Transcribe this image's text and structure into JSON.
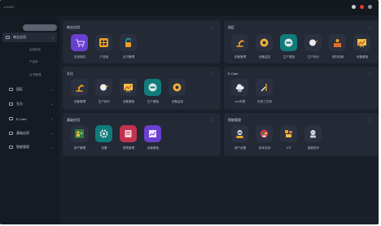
{
  "header": {
    "logo": "LOGO",
    "icons": [
      "settings-icon",
      "notification-icon",
      "avatar-icon"
    ]
  },
  "sidebar": {
    "items": [
      {
        "label": "商业应用",
        "expanded": true
      },
      {
        "label": "园区"
      },
      {
        "label": "孔位"
      },
      {
        "label": "E-Cam"
      },
      {
        "label": "基础应用"
      },
      {
        "label": "智能管理"
      }
    ],
    "sub_items": [
      "应用商店",
      "产品库",
      "证书管理"
    ]
  },
  "cards": {
    "biz": {
      "title": "商业应用",
      "apps": [
        {
          "label": "应用商店",
          "icon": "cart-icon"
        },
        {
          "label": "产品库",
          "icon": "grid-icon"
        },
        {
          "label": "证书管理",
          "icon": "lock-icon"
        }
      ]
    },
    "park": {
      "title": "园区",
      "apps": [
        {
          "label": "设备管理",
          "icon": "robot-arm-icon"
        },
        {
          "label": "设备监控",
          "icon": "disc-icon"
        },
        {
          "label": "生产看板",
          "icon": "gauge-icon"
        },
        {
          "label": "生产统计",
          "icon": "sweep-icon"
        },
        {
          "label": "资料档案",
          "icon": "person-box-icon"
        },
        {
          "label": "设备看板",
          "icon": "board-icon"
        }
      ]
    },
    "hole": {
      "title": "孔位",
      "apps": [
        {
          "label": "设备管理",
          "icon": "robot-arm-icon"
        },
        {
          "label": "生产统计",
          "icon": "sweep-icon"
        },
        {
          "label": "设备看板",
          "icon": "board-icon"
        },
        {
          "label": "生产看板",
          "icon": "gauge-icon"
        },
        {
          "label": "设备监控",
          "icon": "disc-icon"
        }
      ]
    },
    "ecam": {
      "title": "E-Cam",
      "apps": [
        {
          "label": "cnc列表",
          "icon": "cloud-machine-icon"
        },
        {
          "label": "仿真工艺库",
          "icon": "tools-icon"
        }
      ]
    },
    "base": {
      "title": "基础应用",
      "apps": [
        {
          "label": "用户管理",
          "icon": "users-icon"
        },
        {
          "label": "设置",
          "icon": "gear-icon"
        },
        {
          "label": "报表管理",
          "icon": "report-icon"
        },
        {
          "label": "运营看板",
          "icon": "chart-icon"
        }
      ]
    },
    "smart": {
      "title": "智能管理",
      "apps": [
        {
          "label": "用户设置",
          "icon": "operator-icon"
        },
        {
          "label": "技术支持",
          "icon": "support-icon"
        },
        {
          "label": "IOT",
          "icon": "iot-icon"
        },
        {
          "label": "智能助手",
          "icon": "assistant-icon"
        }
      ]
    }
  },
  "colors": {
    "background": "#1a1f29",
    "card": "#232935",
    "sidebar": "#161a22",
    "icon_teal": "#0f7c7a",
    "icon_accent_orange": "#f0a020",
    "icon_purple": "#6a3fd1",
    "icon_red": "#c2334d"
  }
}
